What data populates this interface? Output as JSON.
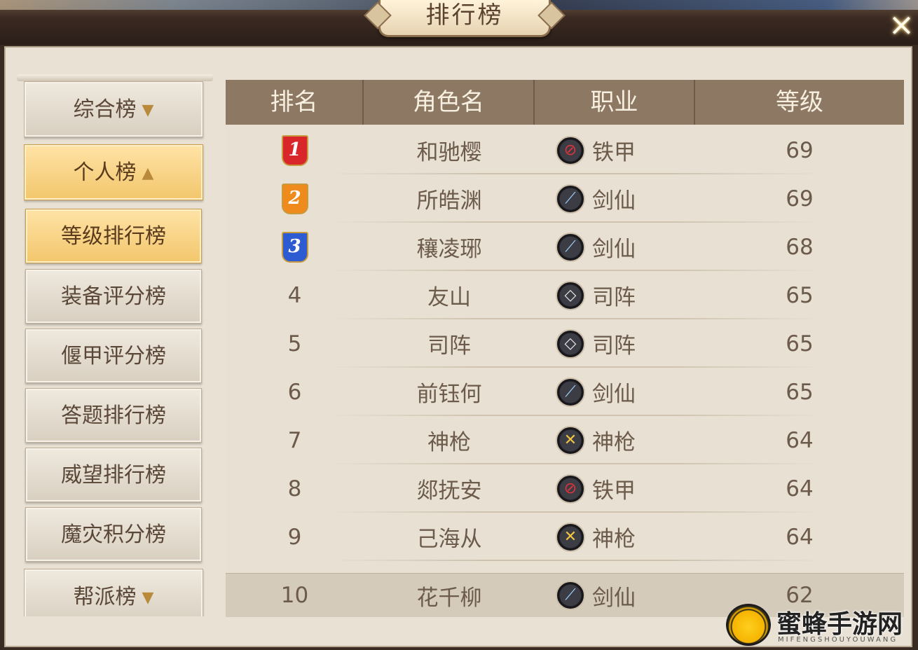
{
  "window": {
    "title": "排行榜",
    "close_icon": "×"
  },
  "sidebar": {
    "items": [
      {
        "label": "综合榜",
        "indicator": "▼",
        "state": "collapsed"
      },
      {
        "label": "个人榜",
        "indicator": "▲",
        "state": "expanded"
      },
      {
        "label": "等级排行榜",
        "state": "selected"
      },
      {
        "label": "装备评分榜"
      },
      {
        "label": "偃甲评分榜"
      },
      {
        "label": "答题排行榜"
      },
      {
        "label": "威望排行榜"
      },
      {
        "label": "魔灾积分榜"
      },
      {
        "label": "帮派榜",
        "indicator": "▼",
        "state": "collapsed"
      }
    ]
  },
  "table": {
    "headers": [
      "排名",
      "角色名",
      "职业",
      "等级"
    ],
    "rows": [
      {
        "rank": "1",
        "name": "和驰樱",
        "job": "铁甲",
        "job_icon": "tiejia-class-icon",
        "level": "69"
      },
      {
        "rank": "2",
        "name": "所皓渊",
        "job": "剑仙",
        "job_icon": "jianxian-class-icon",
        "level": "69"
      },
      {
        "rank": "3",
        "name": "穰凌琊",
        "job": "剑仙",
        "job_icon": "jianxian-class-icon",
        "level": "68"
      },
      {
        "rank": "4",
        "name": "友山",
        "job": "司阵",
        "job_icon": "sizhen-class-icon",
        "level": "65"
      },
      {
        "rank": "5",
        "name": "司阵",
        "job": "司阵",
        "job_icon": "sizhen-class-icon",
        "level": "65"
      },
      {
        "rank": "6",
        "name": "前钰何",
        "job": "剑仙",
        "job_icon": "jianxian-class-icon",
        "level": "65"
      },
      {
        "rank": "7",
        "name": "神枪",
        "job": "神枪",
        "job_icon": "shenqiang-class-icon",
        "level": "64"
      },
      {
        "rank": "8",
        "name": "郯抚安",
        "job": "铁甲",
        "job_icon": "tiejia-class-icon",
        "level": "64"
      },
      {
        "rank": "9",
        "name": "己海从",
        "job": "神枪",
        "job_icon": "shenqiang-class-icon",
        "level": "64"
      }
    ],
    "my_row": {
      "rank": "10",
      "name": "花千柳",
      "job": "剑仙",
      "job_icon": "jianxian-class-icon",
      "level": "62"
    }
  },
  "medal_colors": {
    "1": "#d9262b",
    "2": "#ef8a1d",
    "3": "#2d5bd1"
  },
  "class_colors": {
    "铁甲": "#e0343a",
    "剑仙": "#9fd3ff",
    "司阵": "#e8e8e8",
    "神枪": "#f2c640"
  },
  "watermark": {
    "brand": "蜜蜂手游网",
    "sub": "MIFENGSHOUYOUWANG"
  }
}
